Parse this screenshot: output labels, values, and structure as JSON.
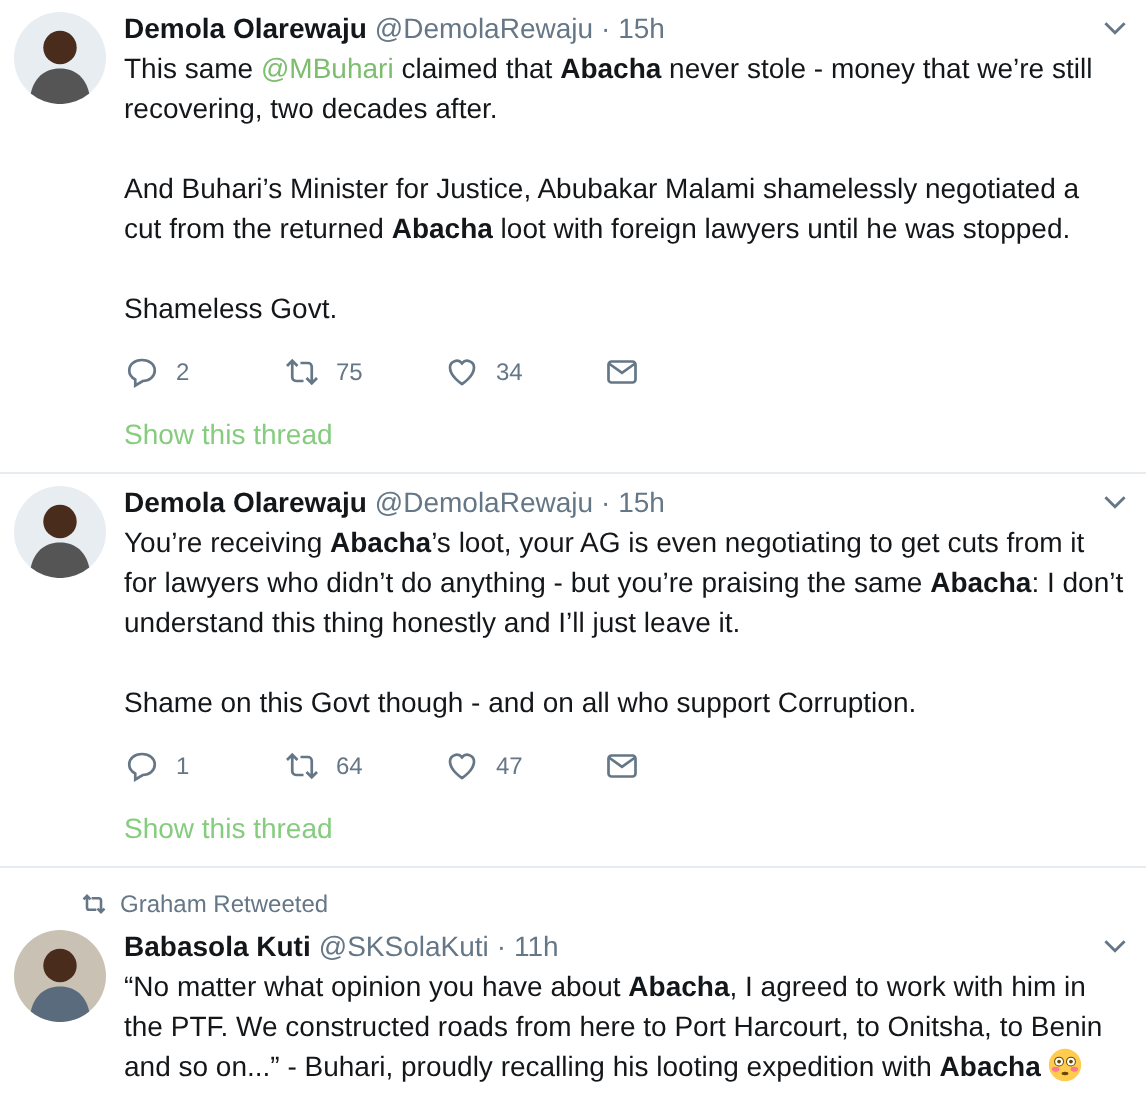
{
  "tweets": [
    {
      "name": "Demola Olarewaju",
      "handle": "@DemolaRewaju",
      "time": "· 15h",
      "paragraphs": [
        [
          {
            "kind": "text",
            "text": "This same "
          },
          {
            "kind": "mention",
            "text": "@MBuhari"
          },
          {
            "kind": "text",
            "text": " claimed that **Abacha** never stole - money that we’re still recovering, two decades after."
          }
        ],
        [
          {
            "kind": "text",
            "text": " And Buhari’s Minister for Justice, Abubakar Malami shamelessly negotiated a cut from the returned **Abacha** loot with foreign lawyers until he was stopped."
          }
        ],
        [
          {
            "kind": "text",
            "text": "Shameless Govt."
          }
        ]
      ],
      "actions": {
        "replies": "2",
        "retweets": "75",
        "likes": "34"
      },
      "thread_link": "Show this thread"
    },
    {
      "name": "Demola Olarewaju",
      "handle": "@DemolaRewaju",
      "time": "· 15h",
      "paragraphs": [
        [
          {
            "kind": "text",
            "text": "You’re receiving **Abacha**’s loot, your AG is even negotiating to get cuts from it for lawyers who didn’t do anything - but you’re praising the same **Abacha**: I don’t understand this thing honestly and I’ll just leave it."
          }
        ],
        [
          {
            "kind": "text",
            "text": "Shame on this Govt though - and on all who support Corruption."
          }
        ]
      ],
      "actions": {
        "replies": "1",
        "retweets": "64",
        "likes": "47"
      },
      "thread_link": "Show this thread"
    },
    {
      "retweeted_by": "Graham Retweeted",
      "name": "Babasola Kuti",
      "handle": "@SKSolaKuti",
      "time": "· 11h",
      "paragraphs": [
        [
          {
            "kind": "text",
            "text": "“No matter what opinion you have about **Abacha**, I agreed to work with him in the PTF. We constructed roads from here to Port Harcourt, to Onitsha, to Benin and so on...” - Buhari, proudly recalling his looting expedition with **Abacha** "
          },
          {
            "kind": "emoji"
          }
        ]
      ]
    }
  ]
}
